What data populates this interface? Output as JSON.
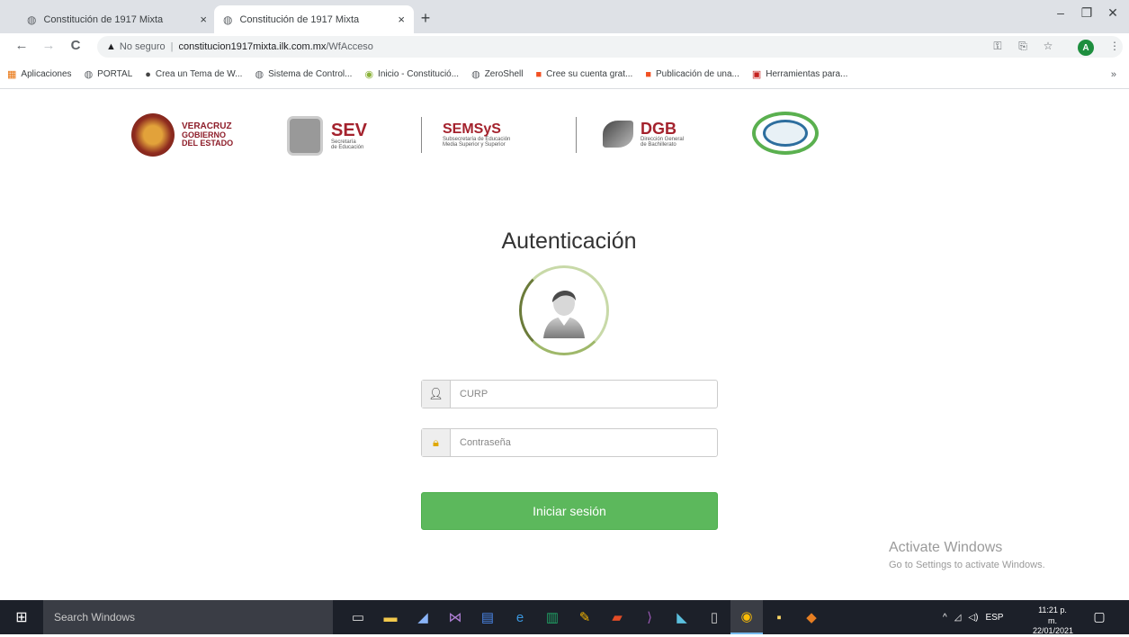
{
  "browser": {
    "tabs": [
      {
        "title": "Constitución de 1917 Mixta",
        "close": "×"
      },
      {
        "title": "Constitución de 1917 Mixta",
        "close": "×"
      }
    ],
    "new_tab": "+",
    "window_controls": {
      "minimize": "–",
      "maximize": "❐",
      "close": "✕"
    },
    "nav": {
      "back": "←",
      "forward": "→",
      "reload": "C"
    },
    "address": {
      "security_label": "No seguro",
      "domain": "constitucion1917mixta.ilk.com.mx",
      "path": "/WfAcceso"
    },
    "profile_initial": "A",
    "bookmarks": [
      {
        "label": "Aplicaciones",
        "icon": "apps-grid-icon",
        "glyph": "▦",
        "color": "#e8710a"
      },
      {
        "label": "PORTAL",
        "icon": "globe-icon",
        "glyph": "◍",
        "color": "#5f6368"
      },
      {
        "label": "Crea un Tema de W...",
        "icon": "wp-icon",
        "glyph": "●",
        "color": "#444444"
      },
      {
        "label": "Sistema de Control...",
        "icon": "globe-icon",
        "glyph": "◍",
        "color": "#5f6368"
      },
      {
        "label": "Inicio - Constitució...",
        "icon": "site-icon",
        "glyph": "◉",
        "color": "#8bb33b"
      },
      {
        "label": "ZeroShell",
        "icon": "globe-icon",
        "glyph": "◍",
        "color": "#5f6368"
      },
      {
        "label": "Cree su cuenta grat...",
        "icon": "microsoft-icon",
        "glyph": "■",
        "color": "#f25022"
      },
      {
        "label": "Publicación de una...",
        "icon": "microsoft-icon",
        "glyph": "■",
        "color": "#f25022"
      },
      {
        "label": "Herramientas para...",
        "icon": "tool-icon",
        "glyph": "▣",
        "color": "#c5221f"
      }
    ],
    "bookmarks_more": "»"
  },
  "logos": {
    "veracruz": {
      "line1": "VERACRUZ",
      "line2": "GOBIERNO",
      "line3": "DEL ESTADO"
    },
    "sev": {
      "name": "SEV",
      "line1": "Secretaría",
      "line2": "de Educación"
    },
    "semsys": {
      "name": "SEMSyS",
      "line1": "Subsecretaría de Educación",
      "line2": "Media Superior y Superior"
    },
    "dgb": {
      "name": "DGB",
      "line1": "Dirección General",
      "line2": "de Bachillerato"
    }
  },
  "auth": {
    "title": "Autenticación",
    "curp_placeholder": "CURP",
    "password_placeholder": "Contraseña",
    "login_label": "Iniciar sesión"
  },
  "watermark": {
    "title": "Activate Windows",
    "subtitle": "Go to Settings to activate Windows."
  },
  "taskbar": {
    "search_placeholder": "Search Windows",
    "language": "ESP",
    "time": "11:21 p. m.",
    "date": "22/01/2021"
  },
  "colors": {
    "primary_button": "#5cb85c",
    "taskbar": "#1c2029"
  }
}
